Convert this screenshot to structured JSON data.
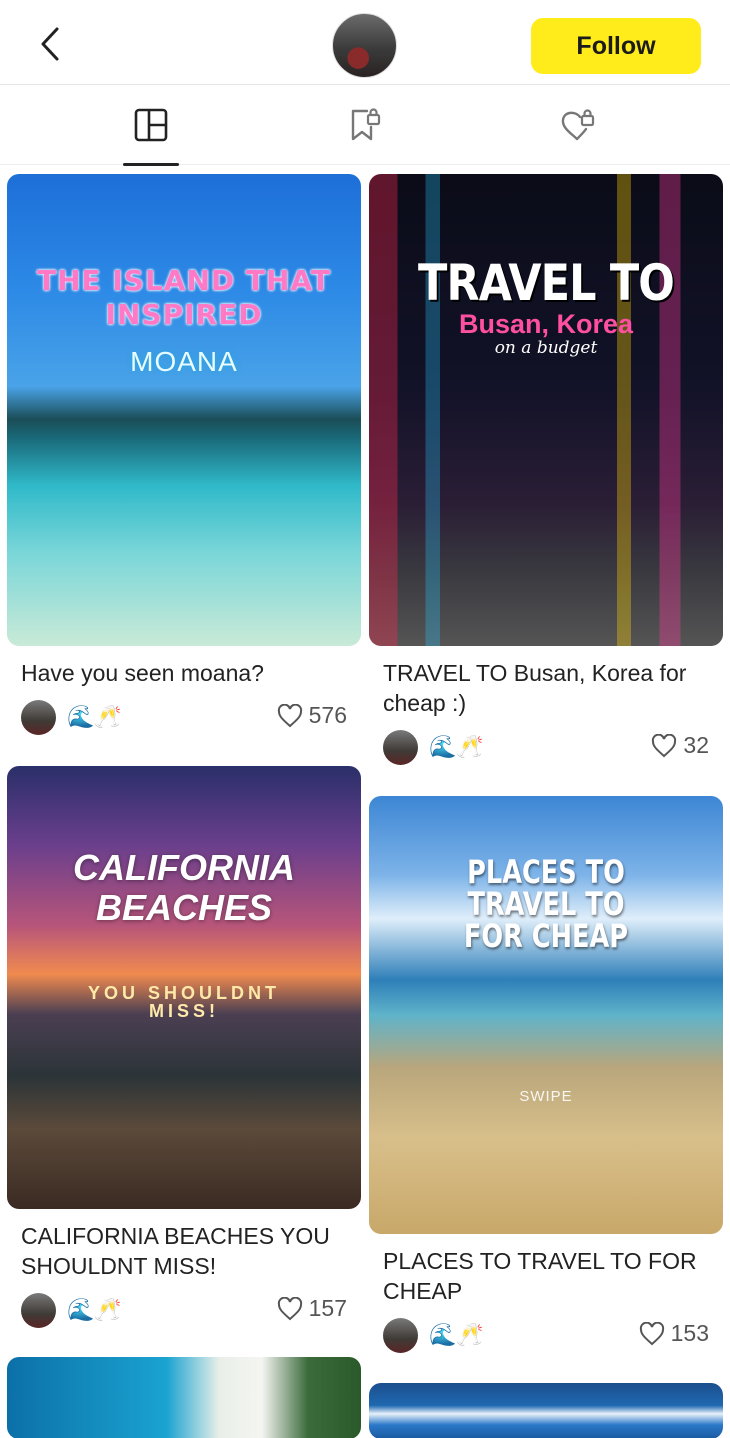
{
  "header": {
    "follow_label": "Follow"
  },
  "tabs": [
    "notes-grid",
    "saved-private",
    "liked-private"
  ],
  "posts": [
    {
      "title": "Have you seen moana?",
      "likes": "576",
      "emoji": "🌊🥂",
      "overlay": [
        "THE ISLAND THAT",
        "INSPIRED",
        "MOANA"
      ]
    },
    {
      "title": "TRAVEL TO Busan, Korea for cheap :)",
      "likes": "32",
      "emoji": "🌊🥂",
      "overlay": [
        "TRAVEL TO",
        "Busan, Korea",
        "on a budget"
      ]
    },
    {
      "title": "CALIFORNIA BEACHES YOU SHOULDNT MISS!",
      "likes": "157",
      "emoji": "🌊🥂",
      "overlay": [
        "CALIFORNIA",
        "BEACHES",
        "YOU SHOULDNT",
        "MISS!"
      ]
    },
    {
      "title": "PLACES TO TRAVEL TO FOR CHEAP",
      "likes": "153",
      "emoji": "🌊🥂",
      "overlay": [
        "PLACES TO",
        "TRAVEL TO",
        "FOR CHEAP",
        "SWIPE"
      ]
    }
  ],
  "icons": {
    "back": "chevron-left-icon",
    "heart": "heart-outline-icon"
  }
}
